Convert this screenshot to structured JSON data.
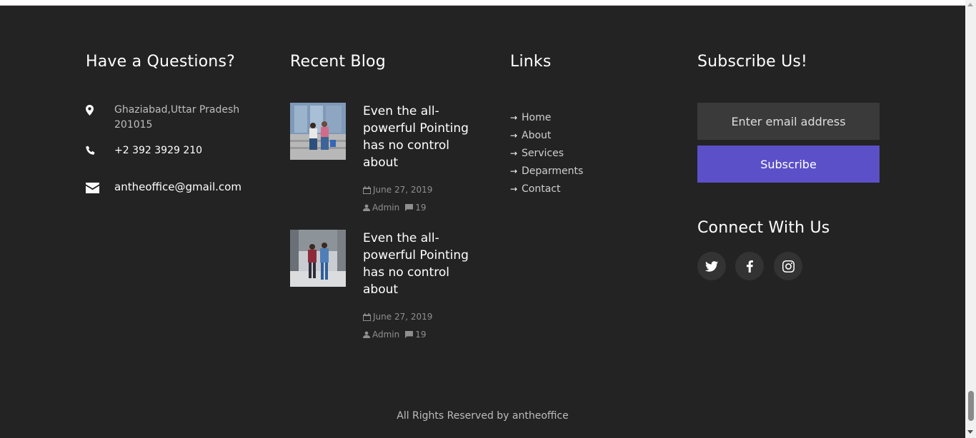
{
  "questions": {
    "title": "Have a Questions?",
    "address": "Ghaziabad,Uttar Pradesh 201015",
    "phone": "+2 392 3929 210",
    "email": "antheoffice@gmail.com",
    "icons": [
      "location-pin-icon",
      "phone-icon",
      "envelope-icon"
    ]
  },
  "blog": {
    "title": "Recent Blog",
    "posts": [
      {
        "title": "Even the all-powerful Pointing has no control about",
        "date": "June 27, 2019",
        "author": "Admin",
        "comments": "19"
      },
      {
        "title": "Even the all-powerful Pointing has no control about",
        "date": "June 27, 2019",
        "author": "Admin",
        "comments": "19"
      }
    ]
  },
  "links": {
    "title": "Links",
    "items": [
      "Home",
      "About",
      "Services",
      "Deparments",
      "Contact"
    ],
    "arrow": "→"
  },
  "subscribe": {
    "title": "Subscribe Us!",
    "email_placeholder": "Enter email address",
    "button_label": "Subscribe"
  },
  "connect": {
    "title": "Connect With Us",
    "icons": [
      "twitter-icon",
      "facebook-icon",
      "instagram-icon"
    ]
  },
  "copyright": "All Rights Reserved by antheoffice",
  "colors": {
    "background": "#232323",
    "accent": "#5b50c8",
    "input_bg": "#3a3a3a",
    "text_muted": "#8f8f8f"
  }
}
